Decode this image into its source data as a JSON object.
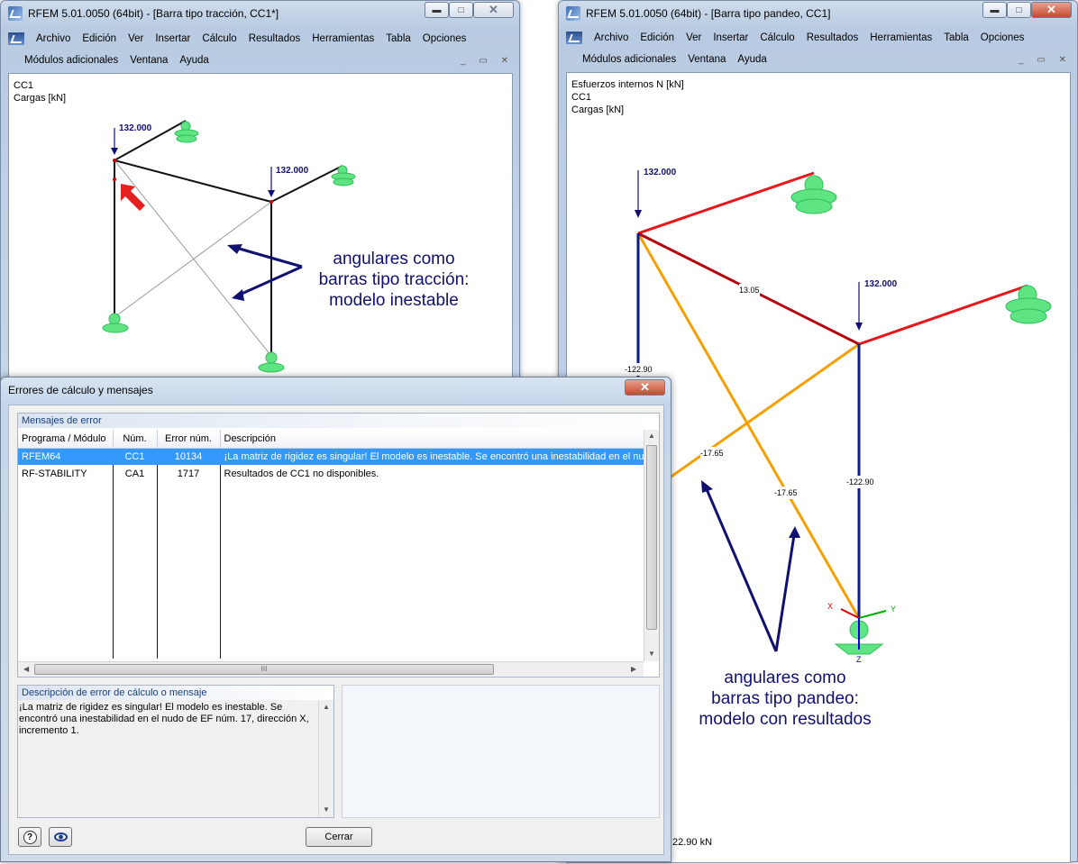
{
  "left_window": {
    "title": "RFEM 5.01.0050 (64bit) - [Barra tipo tracción, CC1*]",
    "menu_row1": [
      "Archivo",
      "Edición",
      "Ver",
      "Insertar",
      "Cálculo",
      "Resultados",
      "Herramientas",
      "Tabla",
      "Opciones"
    ],
    "menu_row2": [
      "Módulos adicionales",
      "Ventana",
      "Ayuda"
    ],
    "info_lines": [
      "CC1",
      "Cargas [kN]"
    ],
    "load_labels": [
      "132.000",
      "132.000"
    ],
    "callout": [
      "angulares como",
      "barras tipo tracción:",
      "modelo inestable"
    ]
  },
  "right_window": {
    "title": "RFEM 5.01.0050 (64bit) - [Barra tipo pandeo, CC1]",
    "menu_row1": [
      "Archivo",
      "Edición",
      "Ver",
      "Insertar",
      "Cálculo",
      "Resultados",
      "Herramientas",
      "Tabla",
      "Opciones"
    ],
    "menu_row2": [
      "Módulos adicionales",
      "Ventana",
      "Ayuda"
    ],
    "info_lines": [
      "Esfuerzos internos N [kN]",
      "CC1",
      "Cargas [kN]"
    ],
    "load_labels": [
      "132.000",
      "132.000"
    ],
    "member_labels": [
      "13.05",
      "-122.90",
      "-122.90",
      "-17.65",
      "-17.65"
    ],
    "axis_labels": [
      "X",
      "Y",
      "Z"
    ],
    "status_text": "22.90 kN",
    "callout": [
      "angulares como",
      "barras tipo pandeo:",
      "modelo con resultados"
    ],
    "colors": {
      "tension": "#e8161b",
      "tension_dark": "#b3000c",
      "compression": "#0d1a8a",
      "diagonal": "#f5a000",
      "support": "#56e07a"
    }
  },
  "dialog": {
    "title": "Errores de cálculo y mensajes",
    "error_group_title": "Mensajes de error",
    "columns": [
      "Programa / Módulo",
      "Núm.",
      "Error núm.",
      "Descripción"
    ],
    "rows": [
      {
        "program": "RFEM64",
        "num": "CC1",
        "error": "10134",
        "desc": "¡La matriz de rigidez es singular! El modelo es inestable. Se encontró una inestabilidad en el nudo de EF núm. 17, dirección X, incremento 1."
      },
      {
        "program": "RF-STABILITY",
        "num": "CA1",
        "error": "1717",
        "desc": "Resultados de CC1 no disponibles."
      }
    ],
    "description_group_title": "Descripción de error de cálculo o mensaje",
    "description_text": "¡La matriz de rigidez es singular! El modelo es inestable. Se encontró una inestabilidad en el nudo de EF núm. 17, dirección X, incremento 1.",
    "close_button": "Cerrar",
    "scroll_grip": "III"
  }
}
